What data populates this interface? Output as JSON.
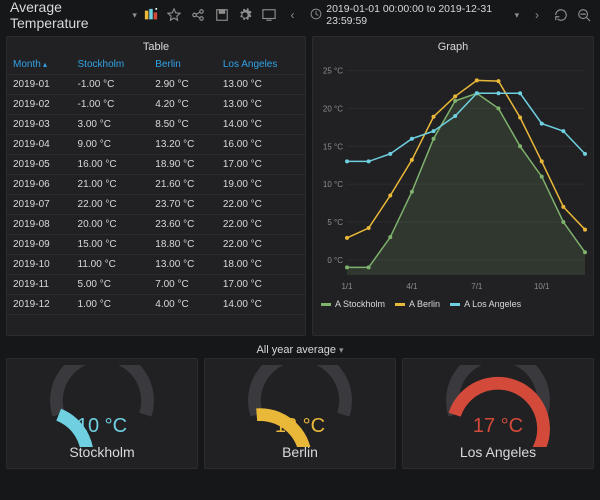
{
  "header": {
    "title": "Average Temperature",
    "time_range": "2019-01-01 00:00:00 to 2019-12-31 23:59:59"
  },
  "table": {
    "title": "Table",
    "columns": [
      "Month",
      "Stockholm",
      "Berlin",
      "Los Angeles"
    ],
    "sort_col": 0,
    "rows": [
      [
        "2019-01",
        "-1.00 °C",
        "2.90 °C",
        "13.00 °C"
      ],
      [
        "2019-02",
        "-1.00 °C",
        "4.20 °C",
        "13.00 °C"
      ],
      [
        "2019-03",
        "3.00 °C",
        "8.50 °C",
        "14.00 °C"
      ],
      [
        "2019-04",
        "9.00 °C",
        "13.20 °C",
        "16.00 °C"
      ],
      [
        "2019-05",
        "16.00 °C",
        "18.90 °C",
        "17.00 °C"
      ],
      [
        "2019-06",
        "21.00 °C",
        "21.60 °C",
        "19.00 °C"
      ],
      [
        "2019-07",
        "22.00 °C",
        "23.70 °C",
        "22.00 °C"
      ],
      [
        "2019-08",
        "20.00 °C",
        "23.60 °C",
        "22.00 °C"
      ],
      [
        "2019-09",
        "15.00 °C",
        "18.80 °C",
        "22.00 °C"
      ],
      [
        "2019-10",
        "11.00 °C",
        "13.00 °C",
        "18.00 °C"
      ],
      [
        "2019-11",
        "5.00 °C",
        "7.00 °C",
        "17.00 °C"
      ],
      [
        "2019-12",
        "1.00 °C",
        "4.00 °C",
        "14.00 °C"
      ]
    ]
  },
  "graph": {
    "title": "Graph",
    "legend": [
      {
        "name": "A Stockholm",
        "color": "#7eb26d"
      },
      {
        "name": "A Berlin",
        "color": "#eab839"
      },
      {
        "name": "A Los Angeles",
        "color": "#6ed0e0"
      }
    ],
    "xticks": [
      "1/1",
      "4/1",
      "7/1",
      "10/1"
    ],
    "yticks": [
      "0 °C",
      "5 °C",
      "10 °C",
      "15 °C",
      "20 °C",
      "25 °C"
    ]
  },
  "section_title": "All year average",
  "gauges": [
    {
      "label": "Stockholm",
      "value": "10 °C",
      "color": "#6ed0e0",
      "frac": 0.4
    },
    {
      "label": "Berlin",
      "value": "13 °C",
      "color": "#eab839",
      "frac": 0.52
    },
    {
      "label": "Los Angeles",
      "value": "17 °C",
      "color": "#d44a3a",
      "frac": 0.68
    }
  ],
  "chart_data": {
    "type": "line",
    "title": "Graph",
    "xlabel": "",
    "ylabel": "",
    "ylim": [
      -1,
      25
    ],
    "x": [
      "2019-01",
      "2019-02",
      "2019-03",
      "2019-04",
      "2019-05",
      "2019-06",
      "2019-07",
      "2019-08",
      "2019-09",
      "2019-10",
      "2019-11",
      "2019-12"
    ],
    "series": [
      {
        "name": "A Stockholm",
        "color": "#7eb26d",
        "values": [
          -1,
          -1,
          3,
          9,
          16,
          21,
          22,
          20,
          15,
          11,
          5,
          1
        ]
      },
      {
        "name": "A Berlin",
        "color": "#eab839",
        "values": [
          2.9,
          4.2,
          8.5,
          13.2,
          18.9,
          21.6,
          23.7,
          23.6,
          18.8,
          13.0,
          7.0,
          4.0
        ]
      },
      {
        "name": "A Los Angeles",
        "color": "#6ed0e0",
        "values": [
          13,
          13,
          14,
          16,
          17,
          19,
          22,
          22,
          22,
          18,
          17,
          14
        ]
      }
    ],
    "gauges": [
      {
        "name": "Stockholm",
        "value": 10,
        "unit": "°C",
        "range": [
          0,
          25
        ]
      },
      {
        "name": "Berlin",
        "value": 13,
        "unit": "°C",
        "range": [
          0,
          25
        ]
      },
      {
        "name": "Los Angeles",
        "value": 17,
        "unit": "°C",
        "range": [
          0,
          25
        ]
      }
    ]
  }
}
